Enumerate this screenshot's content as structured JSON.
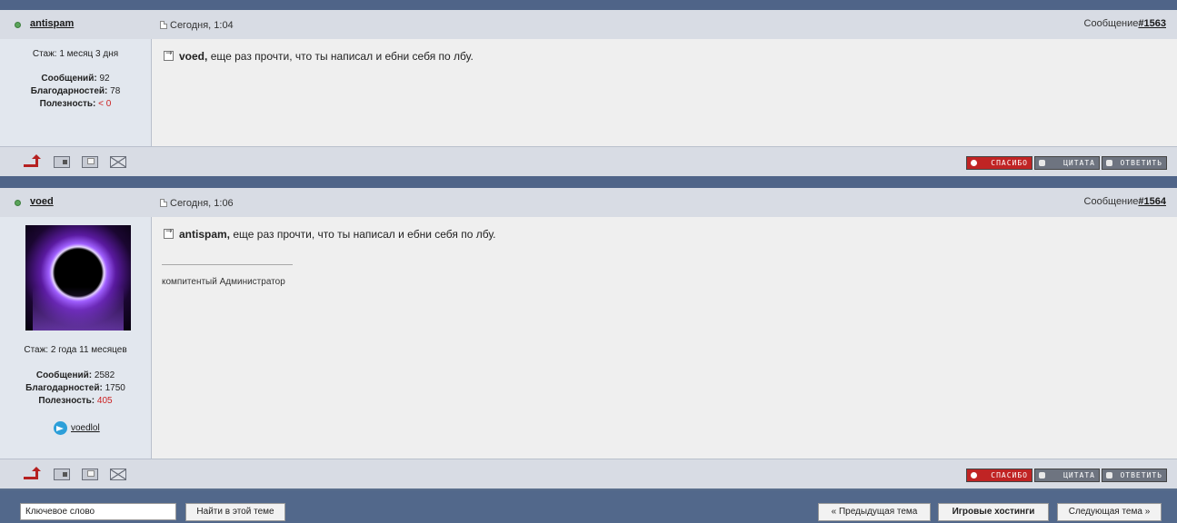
{
  "posts": [
    {
      "author": "antispam",
      "date": "Сегодня, 1:04",
      "msg_prefix": "Сообщение",
      "msg_link": "#1563",
      "tenure": "Стаж: 1 месяц 3 дня",
      "messages_label": "Сообщений:",
      "messages_value": "92",
      "thanks_label": "Благодарностей:",
      "thanks_value": "78",
      "usefulness_label": "Полезность:",
      "usefulness_value": "< 0",
      "quote_to": "voed,",
      "text": "еще раз прочти, что ты написал и ебни себя по лбу."
    },
    {
      "author": "voed",
      "date": "Сегодня, 1:06",
      "msg_prefix": "Сообщение",
      "msg_link": "#1564",
      "tenure": "Стаж: 2 года 11 месяцев",
      "messages_label": "Сообщений:",
      "messages_value": "2582",
      "thanks_label": "Благодарностей:",
      "thanks_value": "1750",
      "usefulness_label": "Полезность:",
      "usefulness_value": "405",
      "quote_to": "antispam,",
      "text": "еще раз прочти, что ты написал и ебни себя по лбу.",
      "signature": "компитентый Администратор",
      "telegram": "voedlol"
    }
  ],
  "actions": {
    "thanks": "спасибо",
    "quote": "цитата",
    "reply": "ответить"
  },
  "footer_nav": {
    "keyword_value": "Ключевое слово",
    "find_label": "Найти в этой теме",
    "prev_label": "« Предыдущая тема",
    "category_label": "Игровые хостинги",
    "next_label": "Следующая тема »"
  },
  "colors": {
    "header_bar": "#4f6488",
    "post_head": "#d8dce4",
    "sidebar": "#e2e7ee",
    "content": "#efefef",
    "thanks_button": "#c02424",
    "negative_value": "#cc2222"
  },
  "icons": [
    "status-dot-icon",
    "doc-icon",
    "quote-reply-icon",
    "up-arrow-icon",
    "profile-icon",
    "pm-icon",
    "mail-icon",
    "heart-icon",
    "telegram-icon"
  ]
}
